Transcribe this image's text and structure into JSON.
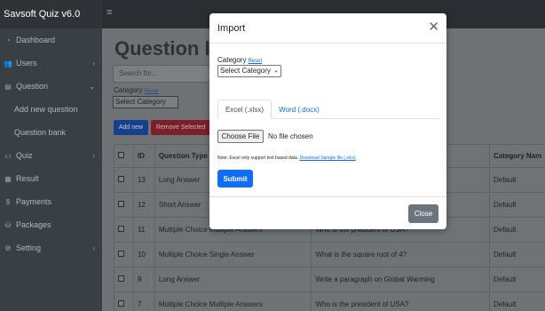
{
  "app": {
    "brand": "Savsoft Quiz v6.0"
  },
  "sidebar": {
    "items": [
      {
        "label": "Dashboard",
        "icon": "dashboard-icon"
      },
      {
        "label": "Users",
        "icon": "users-icon"
      },
      {
        "label": "Question",
        "icon": "question-icon"
      },
      {
        "label": "Add new question"
      },
      {
        "label": "Question bank"
      },
      {
        "label": "Quiz",
        "icon": "quiz-icon"
      },
      {
        "label": "Result",
        "icon": "result-icon"
      },
      {
        "label": "Payments",
        "icon": "dollar-icon"
      },
      {
        "label": "Packages",
        "icon": "packages-icon"
      },
      {
        "label": "Setting",
        "icon": "gear-icon"
      }
    ]
  },
  "main": {
    "title": "Question lis",
    "search_placeholder": "Search for...",
    "category_label": "Category",
    "reset_label": "Reset",
    "category_select": "Select Category",
    "add_button": "Add new",
    "remove_button": "Remove Selected",
    "table": {
      "headers": [
        "",
        "ID",
        "Question Type",
        "",
        "Category Nam"
      ],
      "rows": [
        {
          "id": "13",
          "type": "Long Answer",
          "question": "",
          "category": "Default"
        },
        {
          "id": "12",
          "type": "Short Answer",
          "question": "",
          "category": "Default"
        },
        {
          "id": "11",
          "type": "Multiple Choice Multiple Answers",
          "question": "Who is the president of USA?",
          "category": "Default"
        },
        {
          "id": "10",
          "type": "Multiple Choice Single Answer",
          "question": "What is the square root of 4?",
          "category": "Default"
        },
        {
          "id": "9",
          "type": "Long Answer",
          "question": "Write a paragraph on Global Warming",
          "category": "Default"
        },
        {
          "id": "7",
          "type": "Multiple Choice Multiple Answers",
          "question": "Who is the president of USA?",
          "category": "Default"
        }
      ]
    }
  },
  "modal": {
    "title": "Import",
    "category_label": "Category",
    "reset_label": "Reset",
    "category_select": "Select Category",
    "tabs": [
      "Excel (.xlsx)",
      "Word (.docx)"
    ],
    "choose_file": "Choose File",
    "file_status": "No file chosen",
    "note": "Note: Excel only support text based data.",
    "download_link": "Download Sample file (.xlsx)",
    "submit": "Submit",
    "close": "Close"
  },
  "colors": {
    "primary": "#0d6efd",
    "secondary": "#6c757d",
    "danger": "#dc3545",
    "sidebar": "#343a40"
  }
}
